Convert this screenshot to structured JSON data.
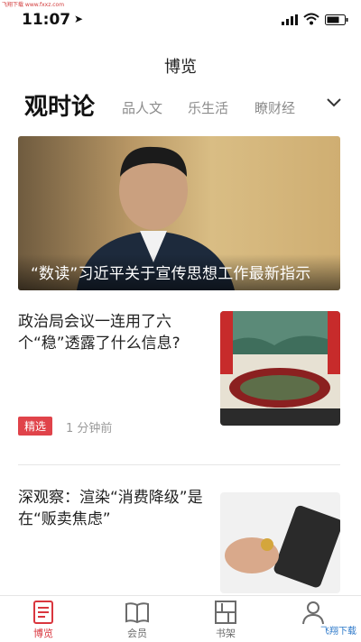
{
  "watermark": "飞翔下载 www.fxxz.com",
  "status": {
    "time": "11:07"
  },
  "header": {
    "title": "博览"
  },
  "tabs": {
    "active": "观时论",
    "items": [
      "品人文",
      "乐生活",
      "瞭财经"
    ]
  },
  "hero": {
    "caption": "“数读”习近平关于宣传思想工作最新指示"
  },
  "articles": [
    {
      "title": "政治局会议一连用了六个“稳”透露了什么信息?",
      "badge": "精选",
      "time": "1 分钟前"
    },
    {
      "title": "深观察：渲染“消费降级”是在“贩卖焦虑”"
    }
  ],
  "tabbar": {
    "items": [
      "博览",
      "会员",
      "书架",
      ""
    ],
    "active_index": 0,
    "accent": "#d9363e"
  },
  "corner_logo": "飞翔下载"
}
